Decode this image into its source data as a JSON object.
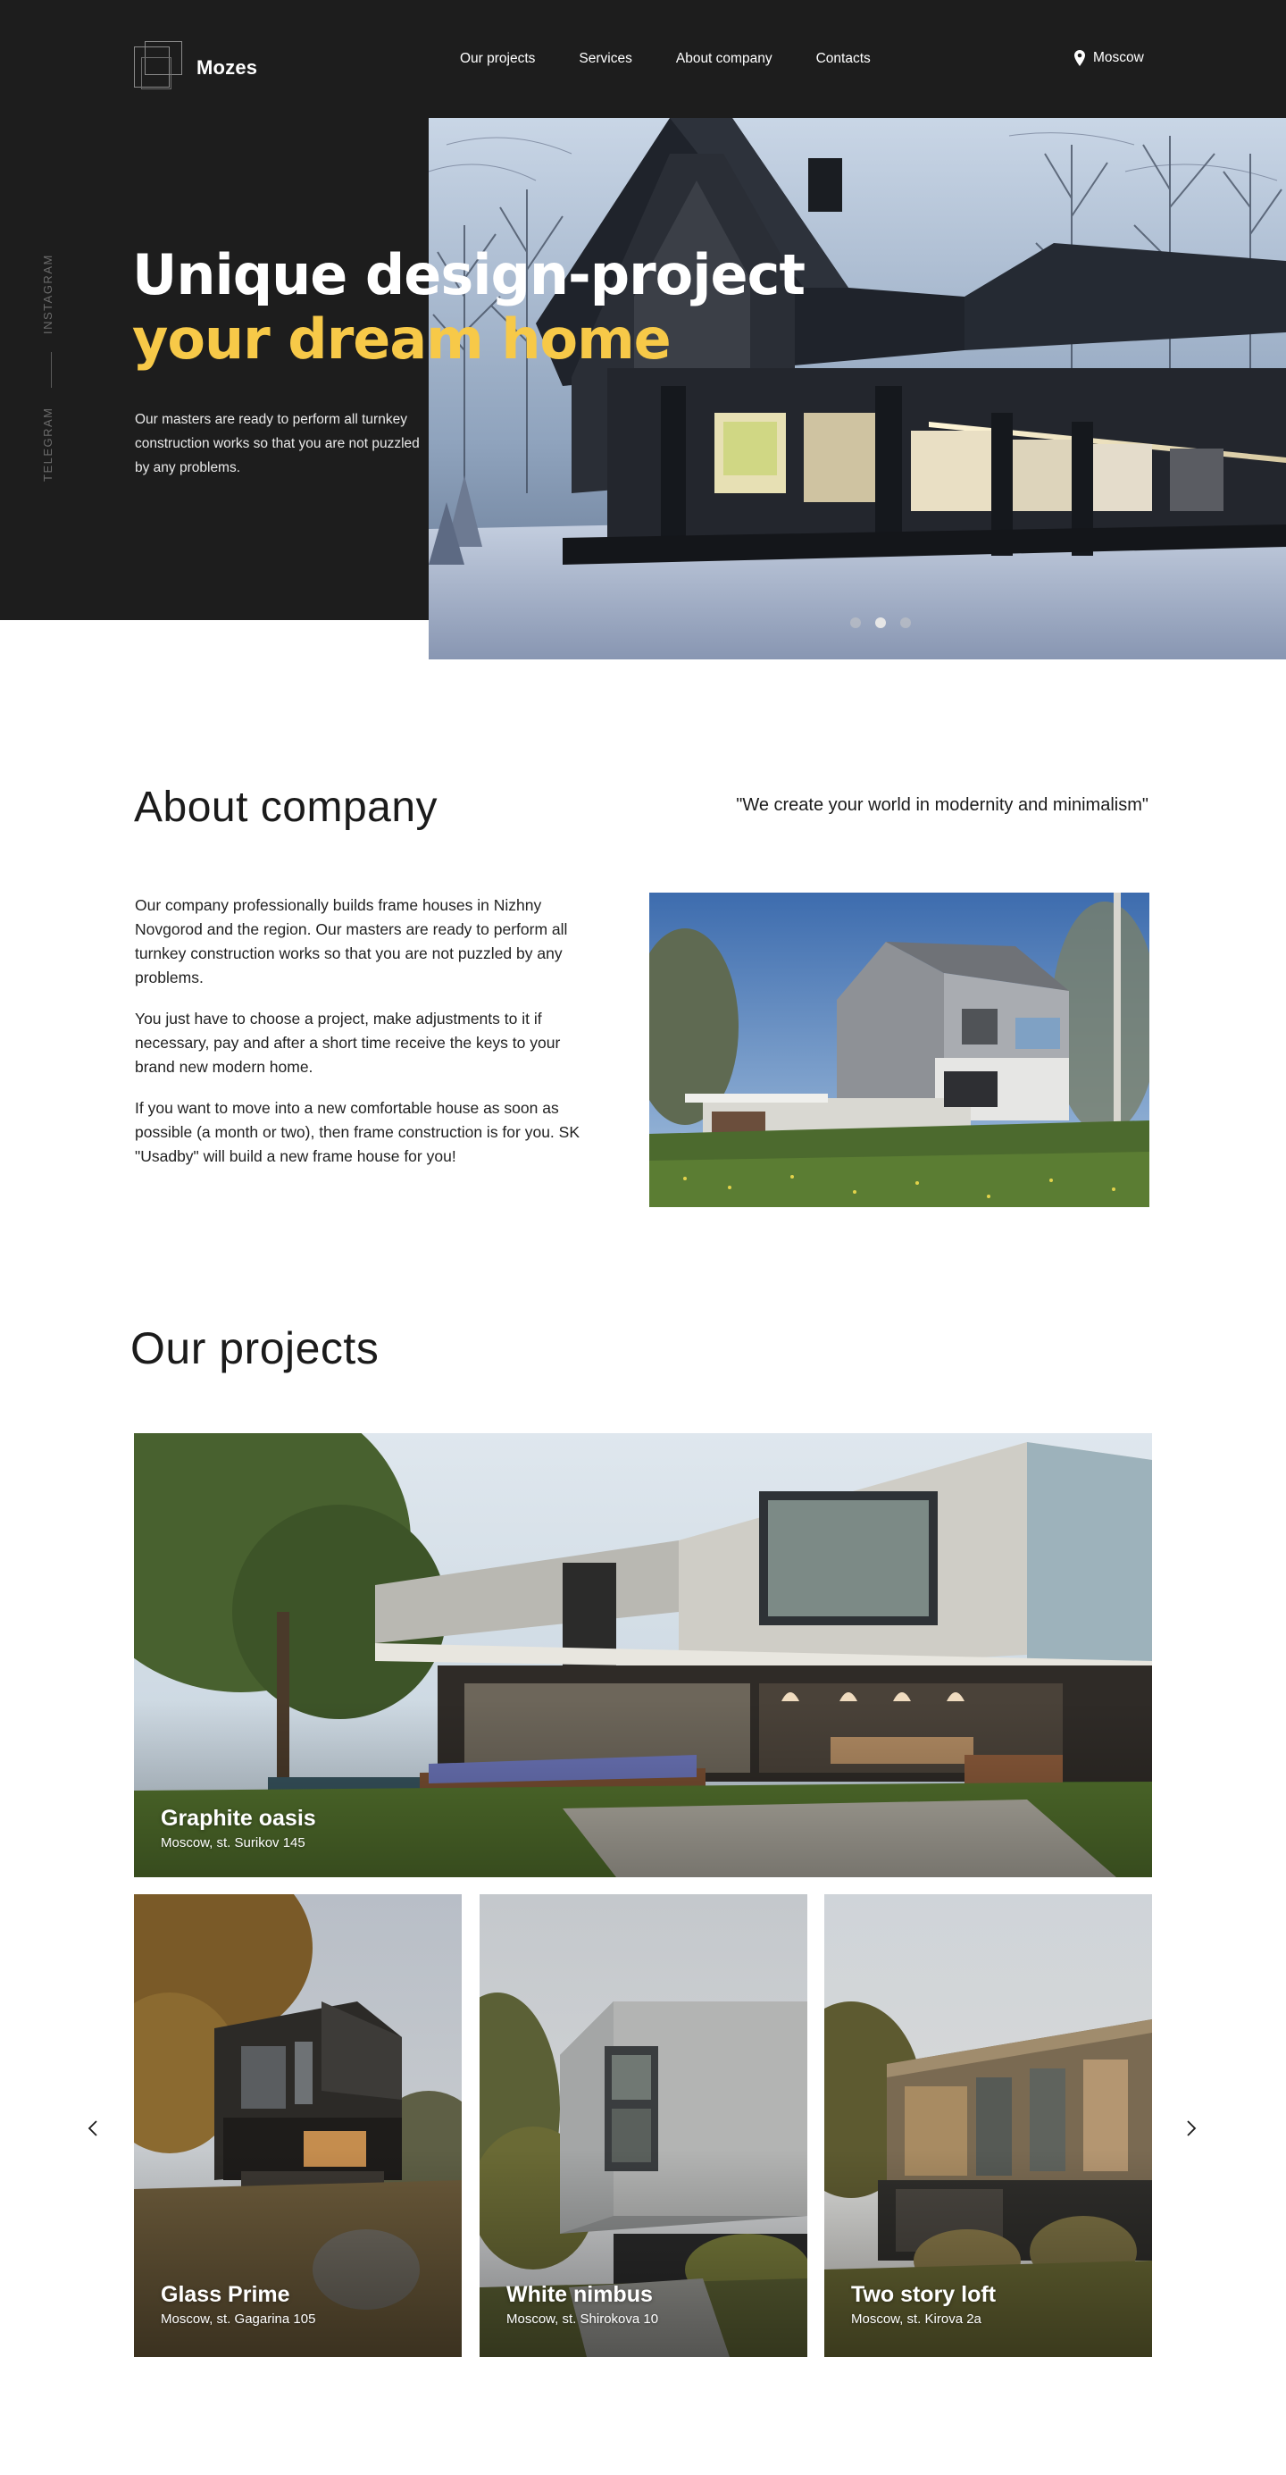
{
  "brand": {
    "name": "Mozes"
  },
  "nav": {
    "items": [
      "Our projects",
      "Services",
      "About company",
      "Contacts"
    ]
  },
  "location": {
    "city": "Moscow",
    "icon": "map-pin-icon"
  },
  "social": {
    "instagram": "INSTAGRAM",
    "telegram": "TELEGRAM"
  },
  "hero": {
    "title_line1": "Unique design-project",
    "title_line2": "your dream home",
    "description": "Our masters are ready to perform all turnkey construction works so that you are not puzzled by any problems.",
    "slides_total": 3,
    "slide_active": 2,
    "accent_color": "#f7c948",
    "background_color": "#1d1d1d"
  },
  "about": {
    "title": "About company",
    "quote": "\"We create your world in modernity and minimalism\"",
    "paragraphs": [
      "Our company professionally builds frame houses in Nizhny Novgorod and the region. Our masters are ready to perform all turnkey construction works so that you are not puzzled by any problems.",
      "You just have to choose a project, make adjustments to it if necessary, pay and after a short time receive the keys to your brand new modern home.",
      "If you want to move into a new comfortable house as soon as possible (a month or two), then frame construction is for you. SK \"Usadby\" will build a new frame house for you!"
    ]
  },
  "projects": {
    "title": "Our projects",
    "featured": {
      "name": "Graphite oasis",
      "address": "Moscow, st. Surikov 145"
    },
    "cards": [
      {
        "name": "Glass Prime",
        "address": "Moscow, st. Gagarina 105"
      },
      {
        "name": "White nimbus",
        "address": "Moscow, st. Shirokova 10"
      },
      {
        "name": "Two story loft",
        "address": "Moscow, st. Kirova 2a"
      }
    ],
    "prev_icon": "chevron-left-icon",
    "next_icon": "chevron-right-icon"
  }
}
